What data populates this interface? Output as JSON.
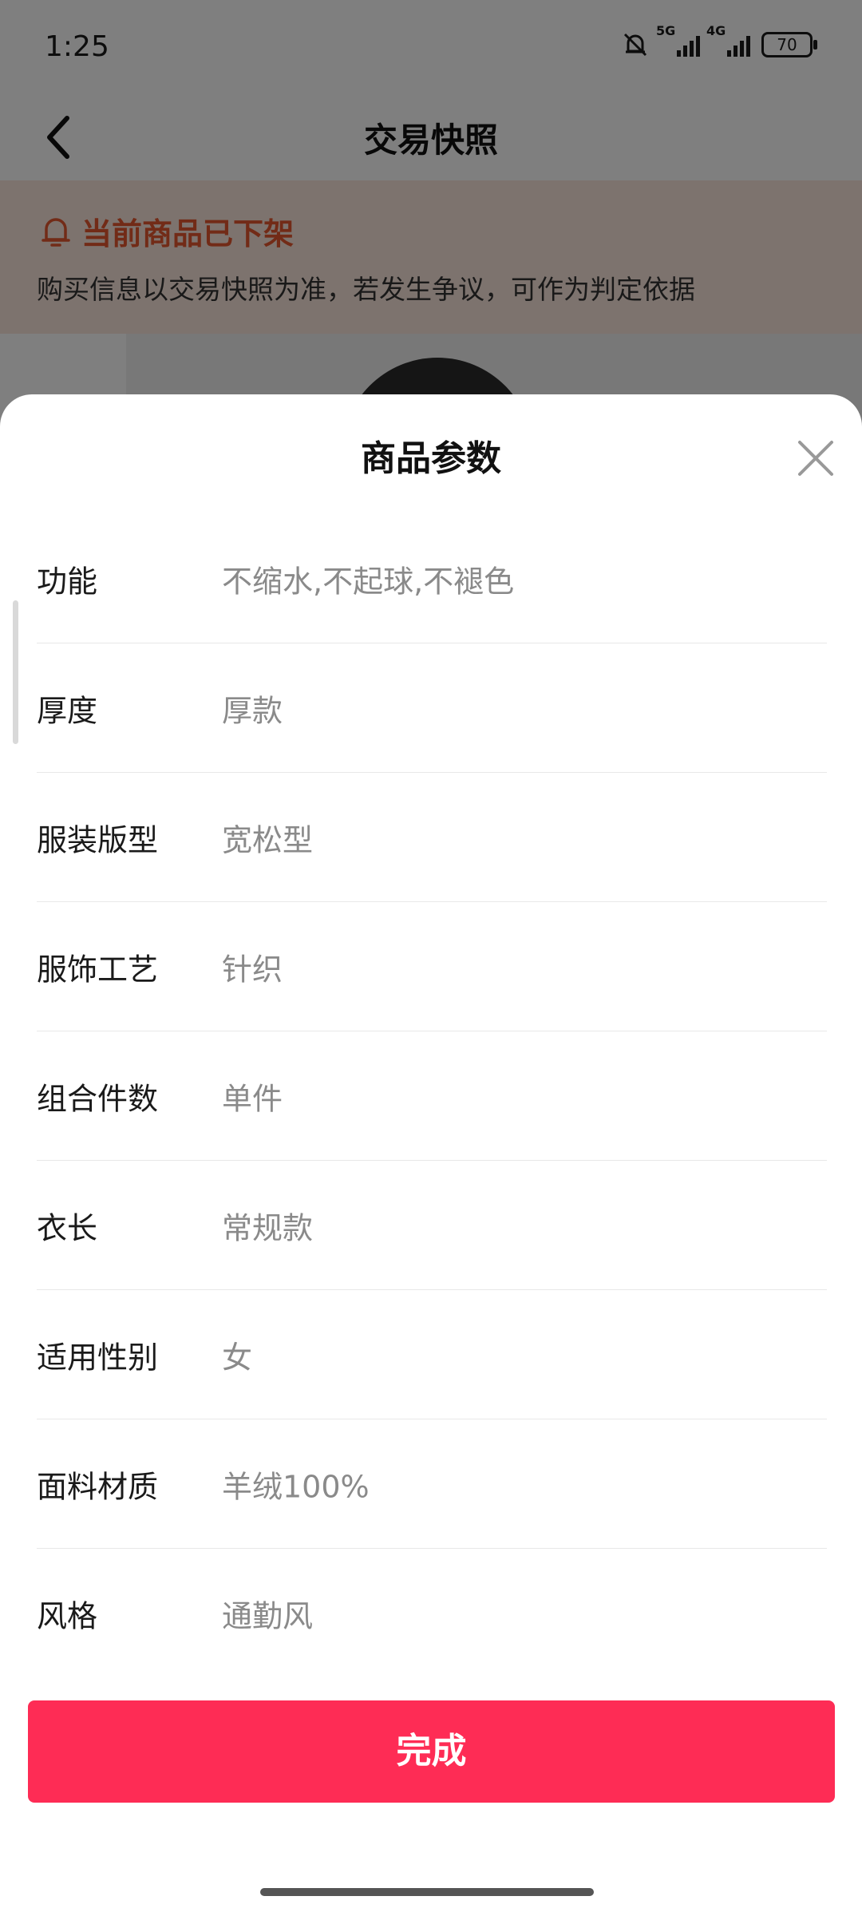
{
  "status_bar": {
    "time": "1:25",
    "net1": "5G",
    "net2": "4G",
    "battery": "70"
  },
  "header": {
    "title": "交易快照"
  },
  "notice": {
    "title": "当前商品已下架",
    "subtitle": "购买信息以交易快照为准，若发生争议，可作为判定依据",
    "color": "#e4572e"
  },
  "sheet": {
    "title": "商品参数",
    "params": [
      {
        "key": "功能",
        "value": "不缩水,不起球,不褪色"
      },
      {
        "key": "厚度",
        "value": "厚款"
      },
      {
        "key": "服装版型",
        "value": "宽松型"
      },
      {
        "key": "服饰工艺",
        "value": "针织"
      },
      {
        "key": "组合件数",
        "value": "单件"
      },
      {
        "key": "衣长",
        "value": "常规款"
      },
      {
        "key": "适用性别",
        "value": "女"
      },
      {
        "key": "面料材质",
        "value": "羊绒100%"
      },
      {
        "key": "风格",
        "value": "通勤风"
      }
    ],
    "done_label": "完成",
    "accent": "#fe2c55"
  }
}
